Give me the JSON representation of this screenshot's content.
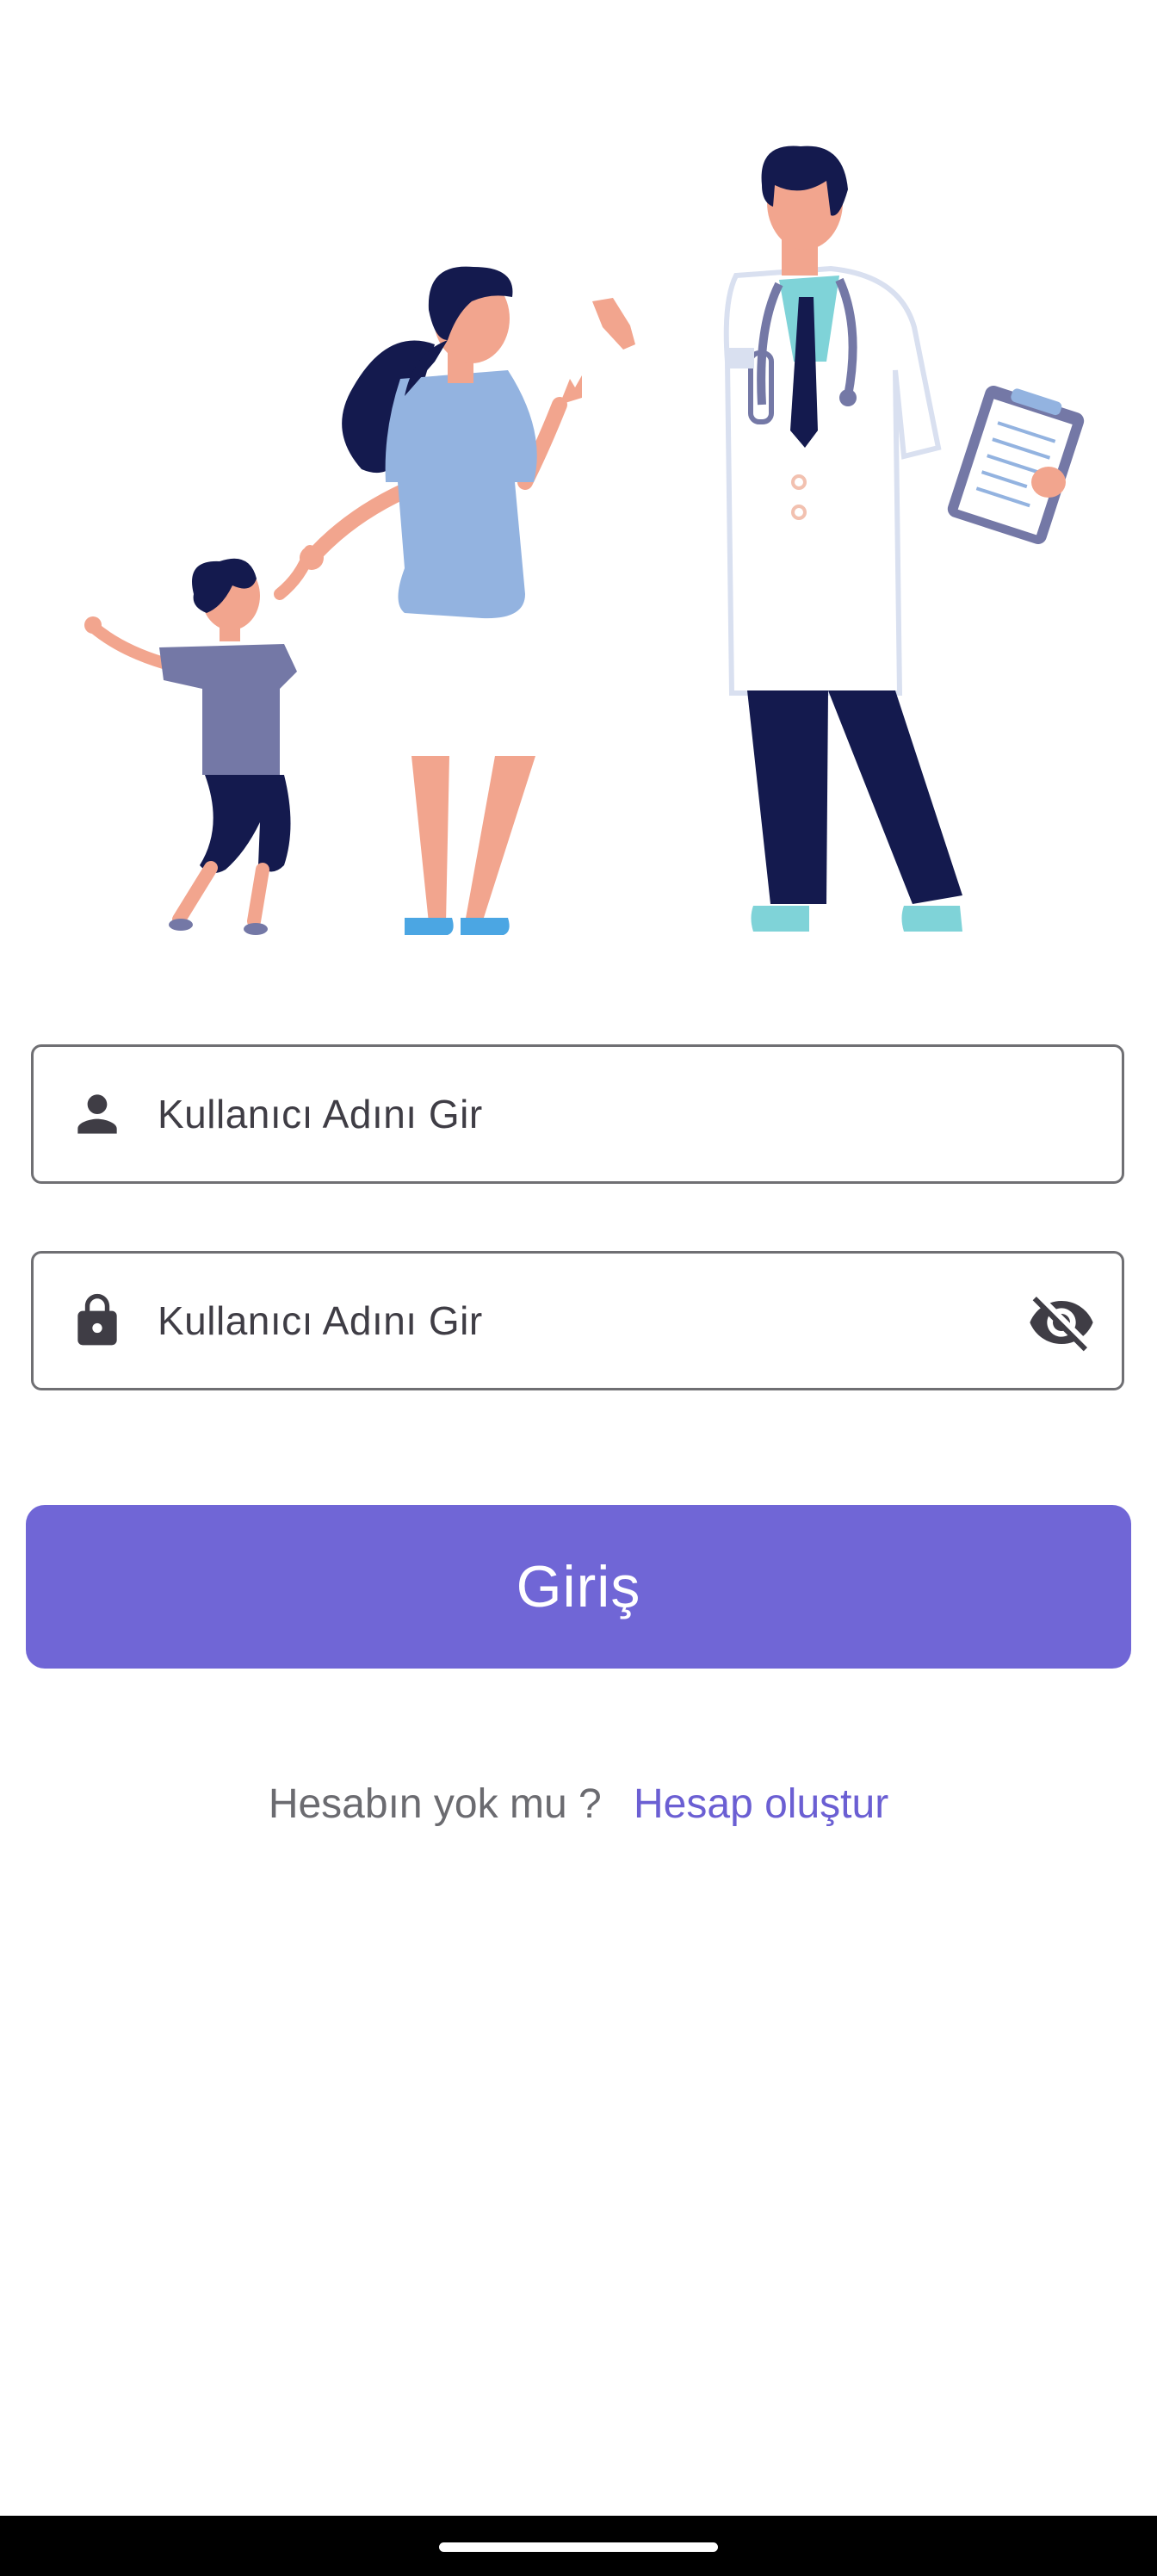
{
  "login_form": {
    "username": {
      "placeholder": "Kullanıcı Adını Gir",
      "value": "",
      "icon": "person-icon"
    },
    "password": {
      "placeholder": "Kullanıcı Adını Gir",
      "value": "",
      "icon": "lock-icon",
      "toggle_icon": "visibility-off-icon"
    },
    "login_label": "Giriş"
  },
  "signup": {
    "prompt": "Hesabın yok mu ?",
    "link_label": "Hesap oluştur"
  },
  "colors": {
    "accent": "#7066d6",
    "link": "#6b5fd3",
    "field_border": "#6f6f73",
    "icon": "#3f3d45"
  }
}
